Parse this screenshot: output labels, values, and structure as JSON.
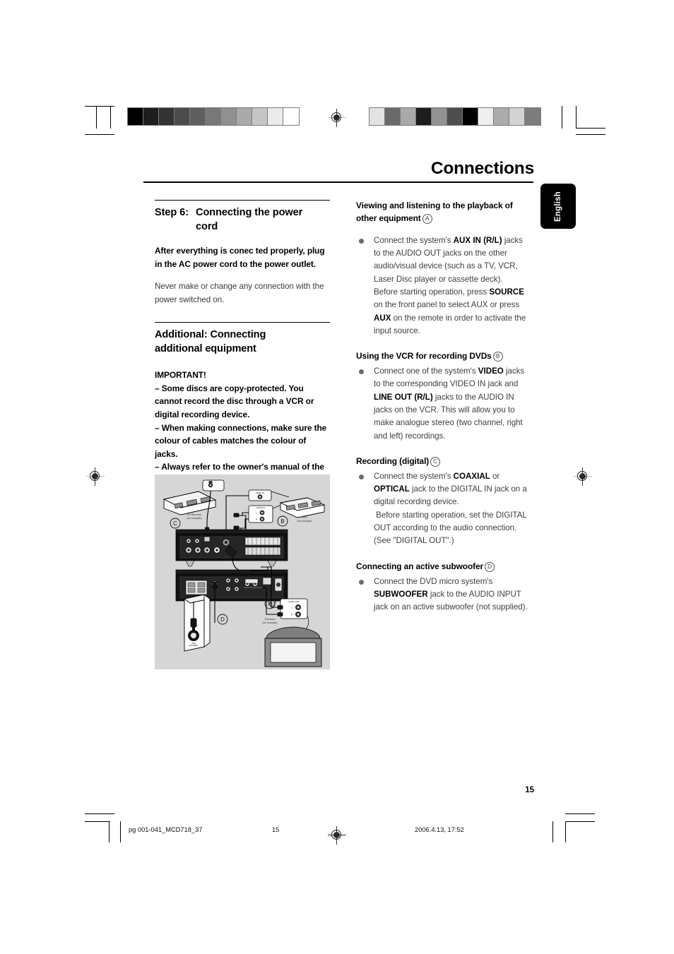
{
  "page": {
    "chapter_title": "Connections",
    "page_number": "15",
    "language_tab": "English"
  },
  "footer": {
    "file_ref": "pg 001-041_MCD718_37",
    "page_label": "15",
    "timestamp": "2006.4.13, 17:52"
  },
  "left_column": {
    "step_label": "Step 6:",
    "step_title_line1": "Connecting the power",
    "step_title_line2": "cord",
    "intro_bold": " After everything is conec ted properly, plug in the AC power cord to the power outlet.",
    "intro_body": "Never make or change any connection with the power switched on.",
    "additional_heading_line1": "Additional: Connecting",
    "additional_heading_line2": "additional equipment",
    "important_label": "IMPORTANT!",
    "important_items": [
      "–   Some discs are copy-protected. You cannot record the disc through a VCR or digital recording device.",
      "–   When making connections, make sure the colour of cables matches the colour of jacks.",
      "–   Always refer to the owner's manual of the other equipment for complete connection and usage details."
    ]
  },
  "right_column": {
    "sections": [
      {
        "heading": "Viewing and listening to the playback of other equipment",
        "marker": "A",
        "body_html": "Connect the system's <b>AUX IN (R/L)</b> jacks to the AUDIO OUT jacks on the other audio/visual device (such as a TV, VCR, Laser Disc player or cassette deck).<br>Before starting operation, press <b>SOURCE</b> on the front panel to select AUX or press <b>AUX</b> on the remote in order to activate the input source."
      },
      {
        "heading": "Using the VCR for recording DVDs",
        "marker": "B",
        "body_html": "Connect one of the system's <b>VIDEO</b> jacks to the corresponding VIDEO IN jack and <b>LINE OUT (R/L)</b> jacks to the AUDIO IN jacks on the VCR. This will allow you to make analogue stereo (two channel, right and left) recordings."
      },
      {
        "heading": "Recording (digital)",
        "marker": "C",
        "body_html": "Connect the system's <b>COAXIAL</b> or <b>OPTICAL</b> jack to the DIGITAL IN jack on a digital recording device.<br>&nbsp;Before starting operation, set the DIGITAL OUT according to the audio connection. (See \"DIGITAL OUT\".)"
      },
      {
        "heading": "Connecting an active subwoofer",
        "marker": "D",
        "body_html": "Connect the DVD micro system's <b>SUBWOOFER</b> jack to the AUDIO INPUT jack on an active subwoofer (not supplied)."
      }
    ]
  },
  "figure": {
    "caption_cd_recorder_line1": "CD Recorder",
    "caption_cd_recorder_line2": "(for example)",
    "caption_vcr_line1": "VCR",
    "caption_vcr_line2": "(for example)",
    "caption_tv_line1": "Television",
    "caption_tv_line2": "(for example)",
    "label_video_in": "VIDEO IN",
    "label_audio_in": "AUDIO IN",
    "label_audio_out": "AUDIO OUT",
    "marker_a": "A",
    "marker_b": "B",
    "marker_c": "C",
    "marker_d": "D",
    "channel_r": "R",
    "channel_l": "L",
    "background_color": "#d6d6d6"
  },
  "calibration": {
    "left_bar": [
      "#000000",
      "#1e1e1e",
      "#333333",
      "#4b4b4b",
      "#5f5f5f",
      "#787878",
      "#909090",
      "#aaaaaa",
      "#c6c6c6",
      "#ebebeb",
      "#ffffff"
    ],
    "right_bar": [
      "#e2e2e2",
      "#6a6a6a",
      "#a9a9a9",
      "#1d1d1d",
      "#929292",
      "#4e4e4e",
      "#000000",
      "#efefef",
      "#acacac",
      "#d3d3d3",
      "#7d7d7d"
    ]
  }
}
